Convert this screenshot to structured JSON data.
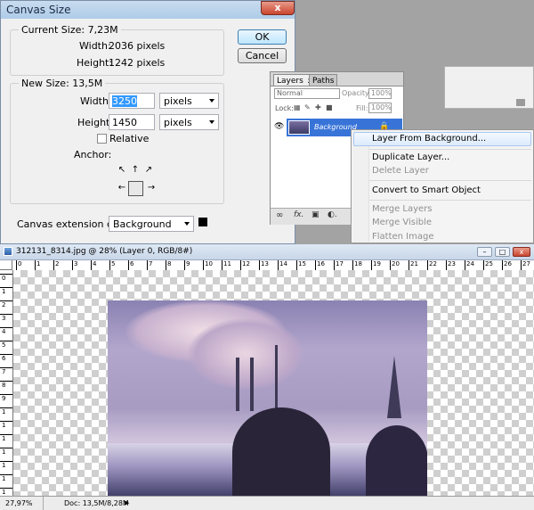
{
  "canvas_size_dialog": {
    "title": "Canvas Size",
    "close_label": "x",
    "current_size": {
      "legend": "Current Size: 7,23M",
      "width_label": "Width:",
      "width_value": "2036 pixels",
      "height_label": "Height:",
      "height_value": "1242 pixels"
    },
    "new_size": {
      "legend": "New Size: 13,5M",
      "width_label": "Width:",
      "width_value": "3250",
      "width_unit": "pixels",
      "height_label": "Height:",
      "height_value": "1450",
      "height_unit": "pixels",
      "relative_label": "Relative",
      "relative_checked": false,
      "anchor_label": "Anchor:"
    },
    "extension_color_label": "Canvas extension color:",
    "extension_color_value": "Background",
    "extension_color_swatch": "#000000",
    "ok_label": "OK",
    "cancel_label": "Cancel"
  },
  "layers_panel": {
    "tabs": [
      "Layers",
      "Paths"
    ],
    "tab_close": "x",
    "blend_mode": "Normal",
    "opacity_label": "Opacity:",
    "opacity_value": "100%",
    "lock_label": "Lock:",
    "fill_label": "Fill:",
    "fill_value": "100%",
    "layer_name": "Background",
    "accent": "#3874d8"
  },
  "context_menu": {
    "items": [
      {
        "label": "Layer From Background...",
        "enabled": true
      },
      {
        "label": "Duplicate Layer...",
        "enabled": true
      },
      {
        "label": "Delete Layer",
        "enabled": false
      },
      {
        "label": "Convert to Smart Object",
        "enabled": true
      },
      {
        "label": "Merge Layers",
        "enabled": false
      },
      {
        "label": "Merge Visible",
        "enabled": false
      },
      {
        "label": "Flatten Image",
        "enabled": false
      }
    ]
  },
  "document": {
    "title": "312131_8314.jpg @ 28% (Layer 0, RGB/8#)",
    "ruler_top": [
      "0",
      "1",
      "2",
      "3",
      "4",
      "5",
      "6",
      "7",
      "8",
      "9",
      "10",
      "11",
      "12",
      "13",
      "14",
      "15",
      "16",
      "17",
      "18",
      "19",
      "20",
      "21",
      "22",
      "23",
      "24",
      "25",
      "26",
      "27"
    ],
    "ruler_left": [
      "0",
      "1",
      "2",
      "3",
      "4",
      "5",
      "6",
      "7",
      "8",
      "9",
      "1",
      "1",
      "1",
      "1",
      "1",
      "1",
      "1"
    ],
    "zoom": "27,97%",
    "doc_info": "Doc: 13,5M/8,28M"
  }
}
